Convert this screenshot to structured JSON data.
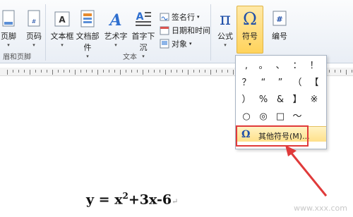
{
  "ribbon": {
    "header_footer": {
      "footer_label": "页脚",
      "page_number_label": "页码",
      "group_label": "眉和页脚"
    },
    "text_group": {
      "textbox_label": "文本框",
      "quickparts_label": "文档部件",
      "wordart_label": "艺术字",
      "dropcap_label": "首字下沉",
      "signature_label": "签名行",
      "datetime_label": "日期和时间",
      "object_label": "对象",
      "group_label": "文本"
    },
    "symbols_group": {
      "equation_label": "公式",
      "symbol_label": "符号",
      "number_label": "编号"
    }
  },
  "dropdown": {
    "symbols": [
      ",",
      "。",
      "、",
      "：",
      "！",
      "？",
      "“",
      "”",
      "（",
      "【",
      "）",
      "%",
      "&",
      "】",
      "※",
      "○",
      "◎",
      "□",
      "～"
    ],
    "more_symbols_label": "其他符号(M)..."
  },
  "document": {
    "formula_prefix": "y = x",
    "formula_exponent": "2",
    "formula_suffix": "+3x-6"
  },
  "watermark": "www.xxx.com"
}
